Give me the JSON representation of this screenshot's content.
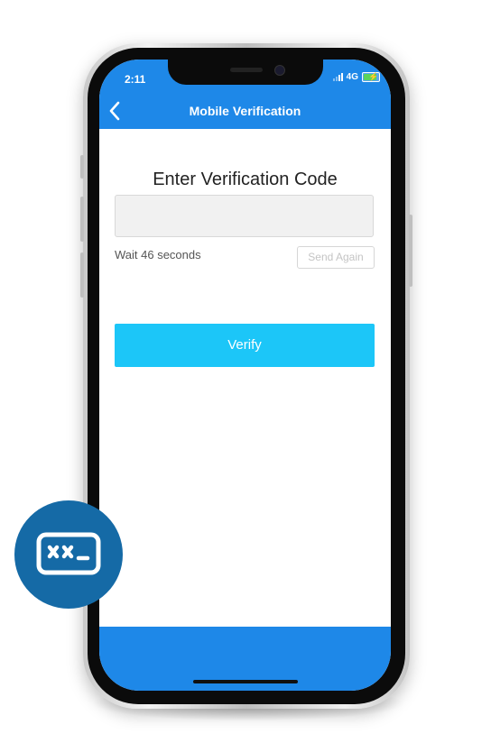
{
  "status_bar": {
    "time": "2:11",
    "network": "4G"
  },
  "nav": {
    "title": "Mobile Verification"
  },
  "main": {
    "heading": "Enter Verification Code",
    "code_value": "",
    "wait_text": "Wait 46 seconds",
    "send_again_label": "Send Again",
    "verify_label": "Verify"
  },
  "colors": {
    "header": "#1e88e8",
    "verify_button": "#1cc6f8",
    "badge": "#156aa6"
  },
  "badge": {
    "icon": "password-field-icon"
  }
}
